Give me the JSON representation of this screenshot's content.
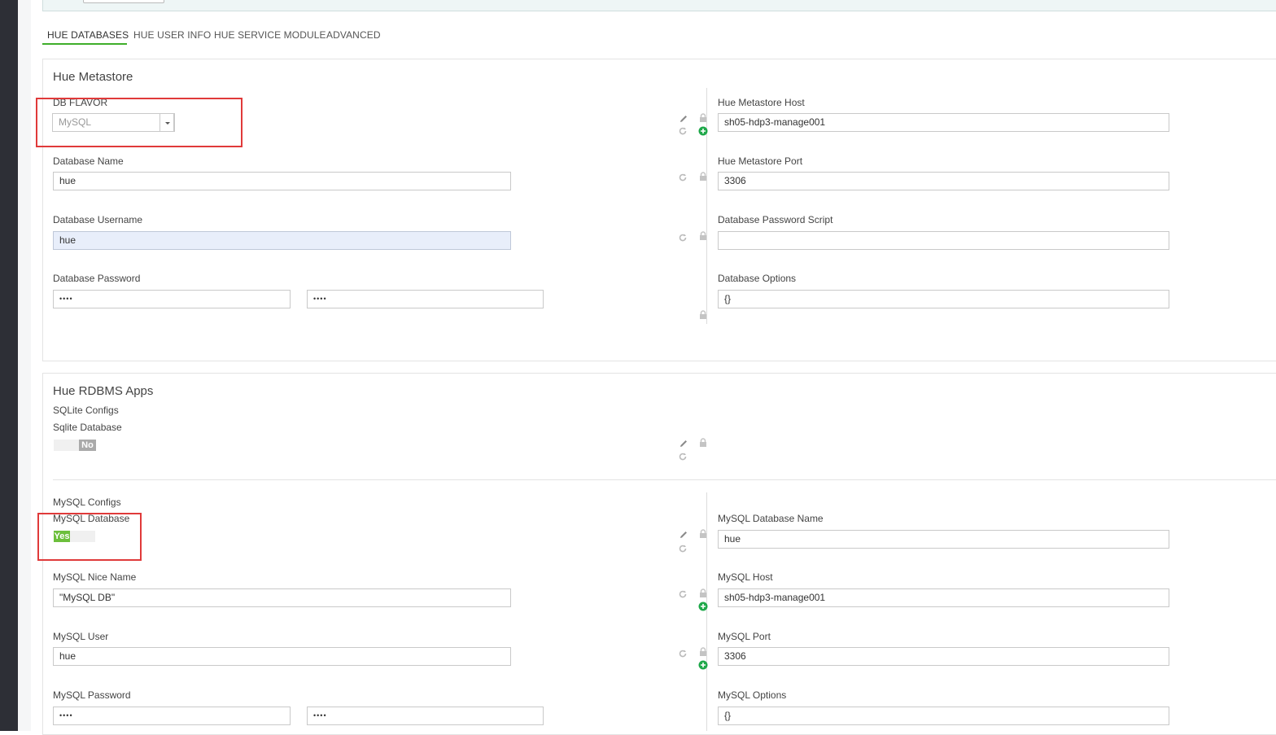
{
  "tabs": [
    {
      "label": "HUE DATABASES"
    },
    {
      "label": "HUE USER INFO"
    },
    {
      "label": "HUE SERVICE MODULE"
    },
    {
      "label": "ADVANCED"
    }
  ],
  "metastore": {
    "title": "Hue Metastore",
    "db_flavor": {
      "label": "DB FLAVOR",
      "value": "MySQL"
    },
    "db_name": {
      "label": "Database Name",
      "value": "hue"
    },
    "db_username": {
      "label": "Database Username",
      "value": "hue"
    },
    "db_password": {
      "label": "Database Password",
      "value": "••••",
      "confirm": "••••"
    },
    "host": {
      "label": "Hue Metastore Host",
      "value": "sh05-hdp3-manage001"
    },
    "port": {
      "label": "Hue Metastore Port",
      "value": "3306"
    },
    "password_script": {
      "label": "Database Password Script",
      "value": ""
    },
    "options": {
      "label": "Database Options",
      "value": "{}"
    }
  },
  "rdbms": {
    "title": "Hue RDBMS Apps",
    "sqlite": {
      "section": "SQLite Configs",
      "label": "Sqlite Database",
      "toggle": "No"
    },
    "mysql": {
      "section": "MySQL Configs",
      "label": "MySQL Database",
      "toggle": "Yes",
      "nice_name": {
        "label": "MySQL Nice Name",
        "value": "\"MySQL DB\""
      },
      "user": {
        "label": "MySQL User",
        "value": "hue"
      },
      "password": {
        "label": "MySQL Password",
        "value": "••••",
        "confirm": "••••"
      },
      "db_name": {
        "label": "MySQL Database Name",
        "value": "hue"
      },
      "host": {
        "label": "MySQL Host",
        "value": "sh05-hdp3-manage001"
      },
      "port": {
        "label": "MySQL Port",
        "value": "3306"
      },
      "options": {
        "label": "MySQL Options",
        "value": "{}"
      }
    }
  },
  "colors": {
    "accent": "#3fae2a",
    "highlight_box": "#e03a3a",
    "add_icon": "#1fa84a",
    "toggle_yes": "#6cbf3c",
    "toggle_no": "#aaaaaa"
  },
  "icons": [
    "pencil-icon",
    "lock-icon",
    "refresh-icon",
    "plus-circle-icon",
    "caret-down-icon"
  ]
}
